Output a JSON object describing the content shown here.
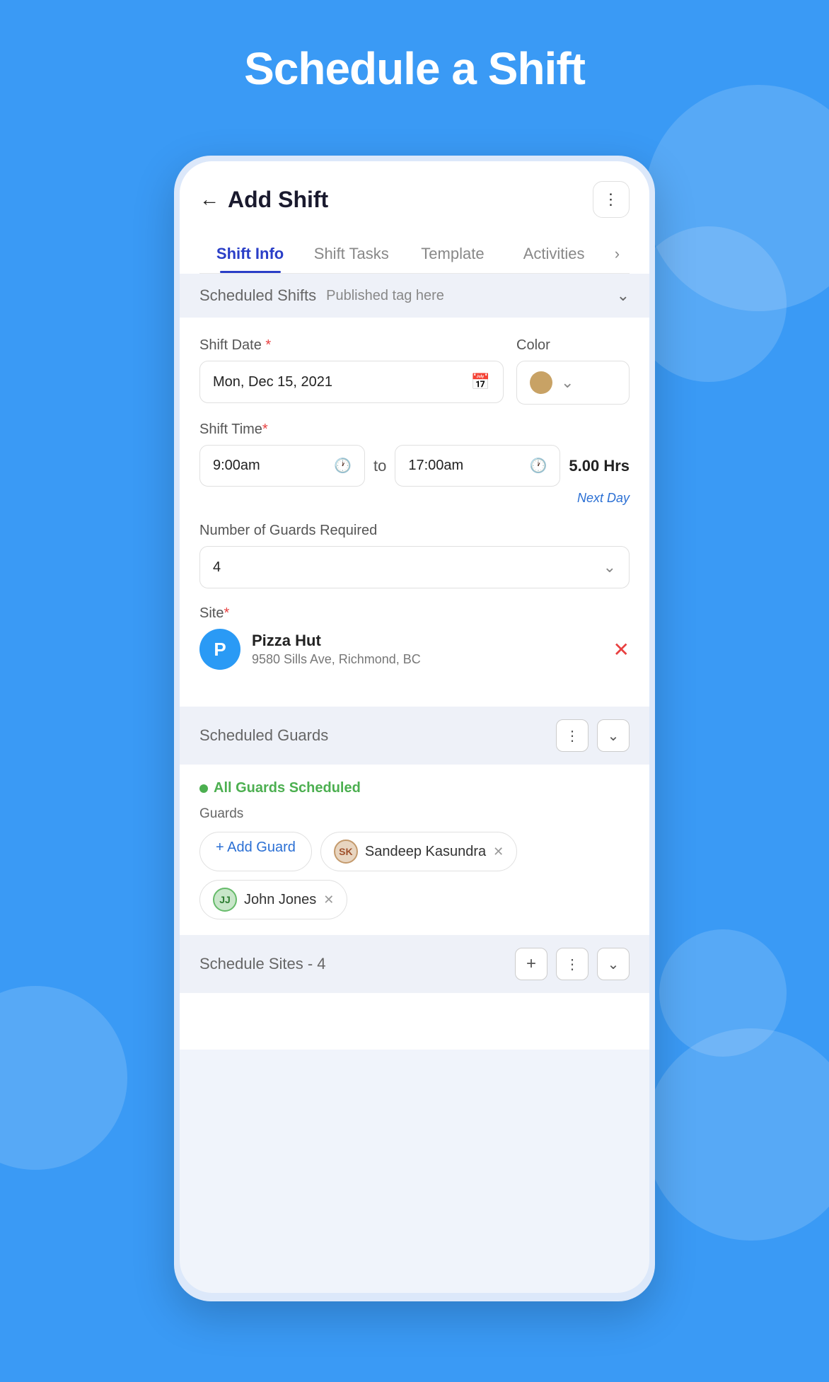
{
  "page": {
    "title": "Schedule a Shift"
  },
  "header": {
    "title": "Add Shift",
    "back_label": "←",
    "more_icon": "⋮"
  },
  "tabs": [
    {
      "label": "Shift Info",
      "active": true
    },
    {
      "label": "Shift Tasks",
      "active": false
    },
    {
      "label": "Template",
      "active": false
    },
    {
      "label": "Activities",
      "active": false
    }
  ],
  "scheduled_shifts": {
    "title": "Scheduled Shifts",
    "tag": "Published tag here"
  },
  "form": {
    "shift_date_label": "Shift Date",
    "shift_date_value": "Mon, Dec 15, 2021",
    "color_label": "Color",
    "shift_time_label": "Shift Time",
    "start_time": "9:00am",
    "to_label": "to",
    "end_time": "17:00am",
    "hrs_label": "5.00 Hrs",
    "next_day_label": "Next Day",
    "guards_required_label": "Number of Guards Required",
    "guards_count": "4",
    "site_label": "Site",
    "site_avatar_letter": "P",
    "site_name": "Pizza Hut",
    "site_address": "9580 Sills Ave, Richmond, BC"
  },
  "scheduled_guards": {
    "title": "Scheduled Guards",
    "status": "All Guards Scheduled",
    "guards_sublabel": "Guards",
    "add_guard_label": "+ Add Guard",
    "guards": [
      {
        "name": "Sandeep Kasundra",
        "initials": "SK",
        "avatar_style": "sk"
      },
      {
        "name": "John Jones",
        "initials": "JJ",
        "avatar_style": "jj"
      }
    ]
  },
  "schedule_sites": {
    "title": "Schedule Sites - 4"
  },
  "icons": {
    "calendar": "📅",
    "clock": "🕐",
    "chevron_down": "⌄",
    "more": "⋮",
    "close": "✕",
    "plus": "+"
  }
}
